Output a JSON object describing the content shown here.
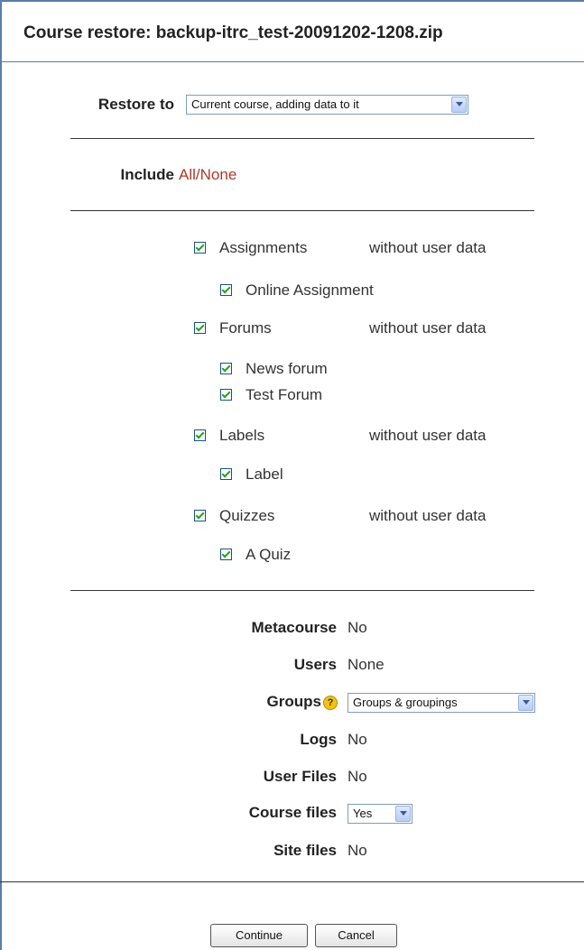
{
  "header": {
    "title": "Course restore: backup-itrc_test-20091202-1208.zip"
  },
  "restore_to": {
    "label": "Restore to",
    "value": "Current course, adding data to it"
  },
  "include": {
    "label": "Include",
    "all": "All",
    "separator": "/",
    "none": "None"
  },
  "modules": [
    {
      "name": "Assignments",
      "user_data": "without user data",
      "checked": true,
      "instances": [
        {
          "name": "Online Assignment",
          "checked": true
        }
      ]
    },
    {
      "name": "Forums",
      "user_data": "without user data",
      "checked": true,
      "instances": [
        {
          "name": "News forum",
          "checked": true
        },
        {
          "name": "Test Forum",
          "checked": true
        }
      ]
    },
    {
      "name": "Labels",
      "user_data": "without user data",
      "checked": true,
      "instances": [
        {
          "name": "Label",
          "checked": true
        }
      ]
    },
    {
      "name": "Quizzes",
      "user_data": "without user data",
      "checked": true,
      "instances": [
        {
          "name": "A Quiz",
          "checked": true
        }
      ]
    }
  ],
  "settings": {
    "metacourse": {
      "label": "Metacourse",
      "value": "No"
    },
    "users": {
      "label": "Users",
      "value": "None"
    },
    "groups": {
      "label": "Groups",
      "value": "Groups & groupings"
    },
    "logs": {
      "label": "Logs",
      "value": "No"
    },
    "user_files": {
      "label": "User Files",
      "value": "No"
    },
    "course_files": {
      "label": "Course files",
      "value": "Yes"
    },
    "site_files": {
      "label": "Site files",
      "value": "No"
    }
  },
  "buttons": {
    "continue": "Continue",
    "cancel": "Cancel"
  },
  "colors": {
    "frame": "#5b7ba8",
    "link": "#aa3a2a",
    "check": "#21a121"
  }
}
